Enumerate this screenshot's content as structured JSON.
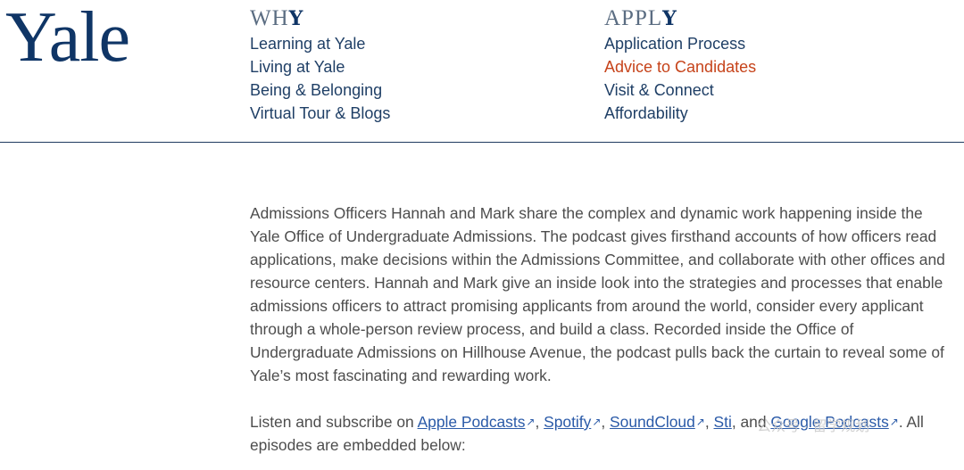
{
  "logo": "Yale",
  "nav": {
    "why": {
      "heading_main": "WH",
      "heading_bold": "Y",
      "links": [
        "Learning at Yale",
        "Living at Yale",
        "Being & Belonging",
        "Virtual Tour & Blogs"
      ]
    },
    "apply": {
      "heading_main": "APPL",
      "heading_bold": "Y",
      "links": [
        "Application Process",
        "Advice to Candidates",
        "Visit & Connect",
        "Affordability"
      ],
      "active": "Advice to Candidates"
    }
  },
  "content": {
    "intro": "Admissions Officers Hannah and Mark share the complex and dynamic work happening inside the Yale Office of Undergraduate Admissions. The podcast gives firsthand accounts of how officers read applications, make decisions within the Admissions Committee, and collaborate with other offices and resource centers. Hannah and Mark give an inside look into the strategies and processes that enable admissions officers to attract promising applicants from around the world, consider every applicant through a whole-person review process, and build a class. Recorded inside the Office of Undergraduate Admissions on Hillhouse Avenue, the podcast pulls back the curtain to reveal some of Yale’s most fascinating and rewarding work.",
    "listen_prefix": "Listen and subscribe on ",
    "links": [
      "Apple Podcasts",
      "Spotify",
      "SoundCloud",
      "Sti"
    ],
    "separator": ", ",
    "and": ", and ",
    "last_link": "Google Podcasts",
    "listen_suffix": ". All episodes are embedded below:"
  },
  "watermark": "公众号 · 留学规划"
}
